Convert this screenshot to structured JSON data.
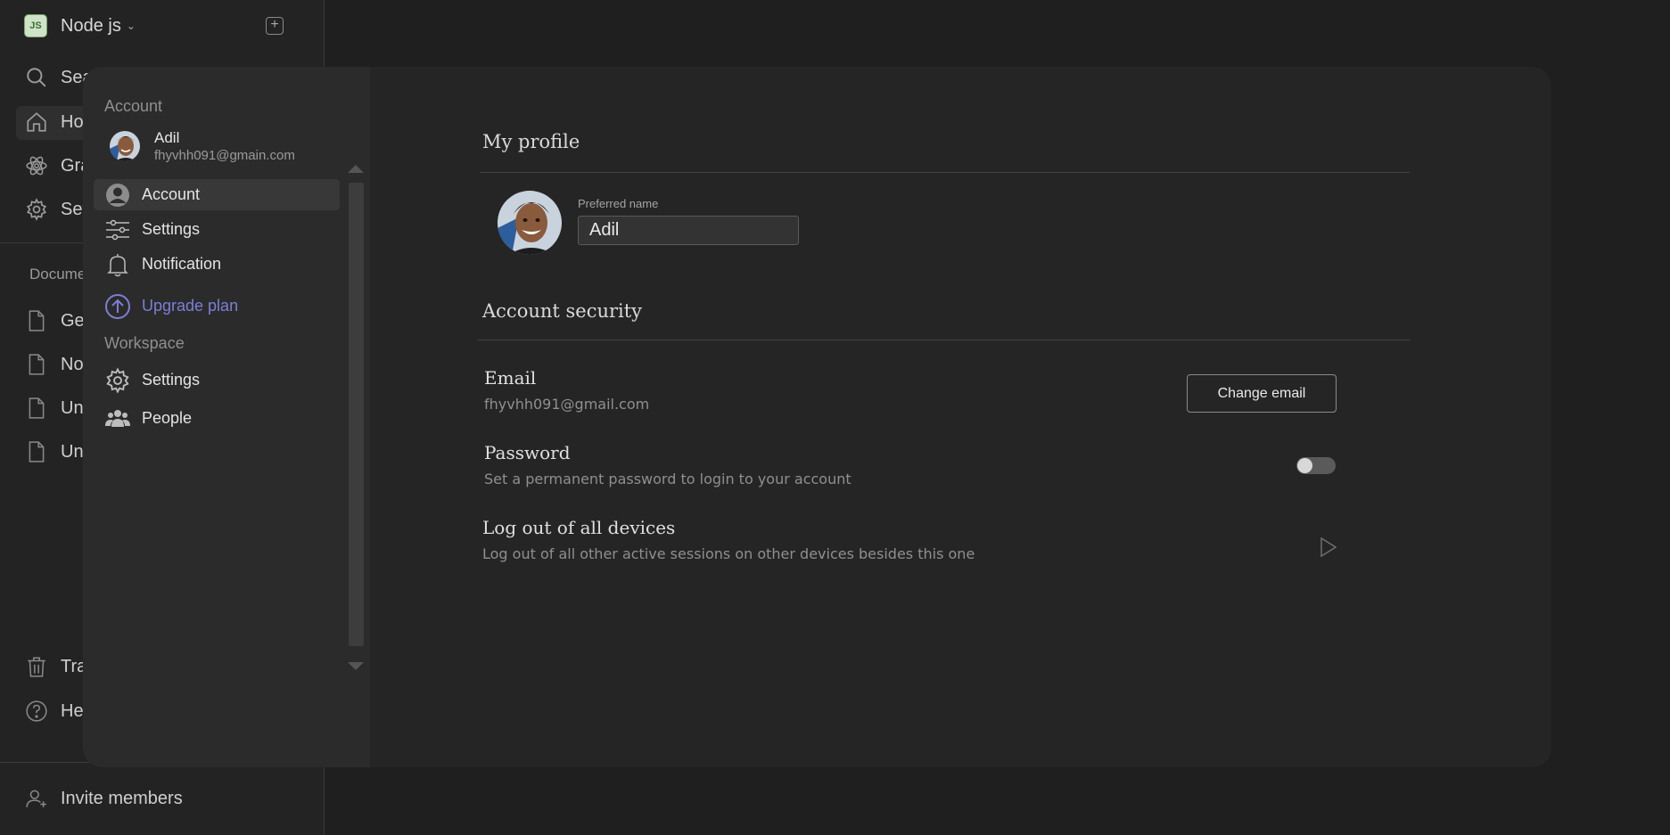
{
  "app_sidebar": {
    "workspace_name": "Node js",
    "workspace_logo": "JS",
    "add_icon": "+",
    "items": [
      {
        "label": "Search",
        "icon": "search-icon"
      },
      {
        "label": "Home",
        "icon": "home-icon"
      },
      {
        "label": "Graph",
        "icon": "graph-icon"
      },
      {
        "label": "Settings",
        "icon": "gear-icon"
      }
    ],
    "documents_label": "Documents",
    "documents": [
      "Getting started",
      "Notes",
      "Untitled",
      "Untitled"
    ],
    "footer_items": [
      {
        "label": "Trash",
        "icon": "trash-icon"
      },
      {
        "label": "Help",
        "icon": "help-icon"
      }
    ],
    "invite_label": "Invite members"
  },
  "settings_nav": {
    "account_section": "Account",
    "user": {
      "name": "Adil",
      "email": "fhyvhh091@gmain.com"
    },
    "items": [
      {
        "label": "Account",
        "icon": "user-circle-icon",
        "active": true
      },
      {
        "label": "Settings",
        "icon": "sliders-icon"
      },
      {
        "label": "Notification",
        "icon": "bell-icon"
      },
      {
        "label": "Upgrade plan",
        "icon": "arrow-up-circle-icon",
        "accent": "#7c7fd6"
      }
    ],
    "workspace_section": "Workspace",
    "workspace_items": [
      {
        "label": "Settings",
        "icon": "gear-icon"
      },
      {
        "label": "People",
        "icon": "people-icon"
      }
    ]
  },
  "profile": {
    "title": "My profile",
    "preferred_name_label": "Preferred name",
    "preferred_name_value": "Adil"
  },
  "security": {
    "title": "Account security",
    "email_title": "Email",
    "email_value": "fhyvhh091@gmail.com",
    "change_email_label": "Change email",
    "password_title": "Password",
    "password_sub": "Set a permanent password to login to your account",
    "password_toggle_on": false,
    "logout_title": "Log out of all devices",
    "logout_sub": "Log out of all other active sessions on other devices besides this one"
  },
  "colors": {
    "background": "#1f1f1f",
    "modal": "#252525",
    "nav": "#2b2b2b",
    "accent": "#7c7fd6"
  }
}
